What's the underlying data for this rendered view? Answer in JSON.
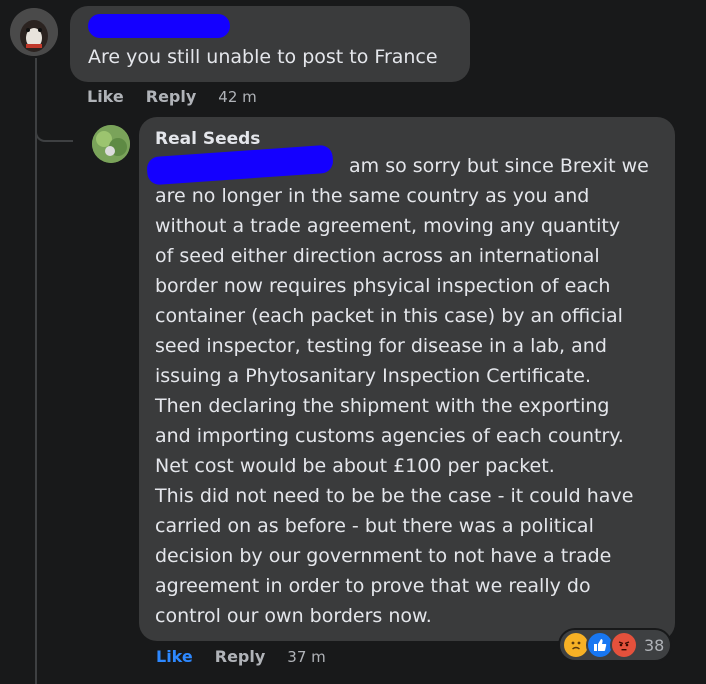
{
  "comment1": {
    "text": "Are you still unable to post to France",
    "like_label": "Like",
    "reply_label": "Reply",
    "time": "42 m"
  },
  "comment2": {
    "author": "Real Seeds",
    "lines": [
      "am so sorry but since Brexit we",
      "are no longer in the same country as you and",
      "without a trade agreement, moving any quantity",
      "of seed either direction across an international",
      "border now requires phsyical inspection of each",
      "container (each packet in this case) by an official",
      "seed inspector, testing for disease in a lab, and",
      "issuing a Phytosanitary Inspection Certificate.",
      "Then declaring the shipment with the exporting",
      "and importing customs agencies of each country.",
      "Net cost would be about £100 per packet.",
      "This did not need to be be the case - it could have",
      "carried on as before - but there was a political",
      "decision by our government to not have a trade",
      "agreement in order to prove that we really do",
      "control our own borders now."
    ],
    "like_label": "Like",
    "reply_label": "Reply",
    "time": "37 m",
    "reactions": {
      "icons": [
        "sad-icon",
        "like-icon",
        "angry-icon"
      ],
      "count": "38"
    }
  },
  "colors": {
    "background": "#18191a",
    "bubble": "#3a3b3c",
    "like_active": "#2d88ff",
    "redaction": "#1400ff"
  }
}
